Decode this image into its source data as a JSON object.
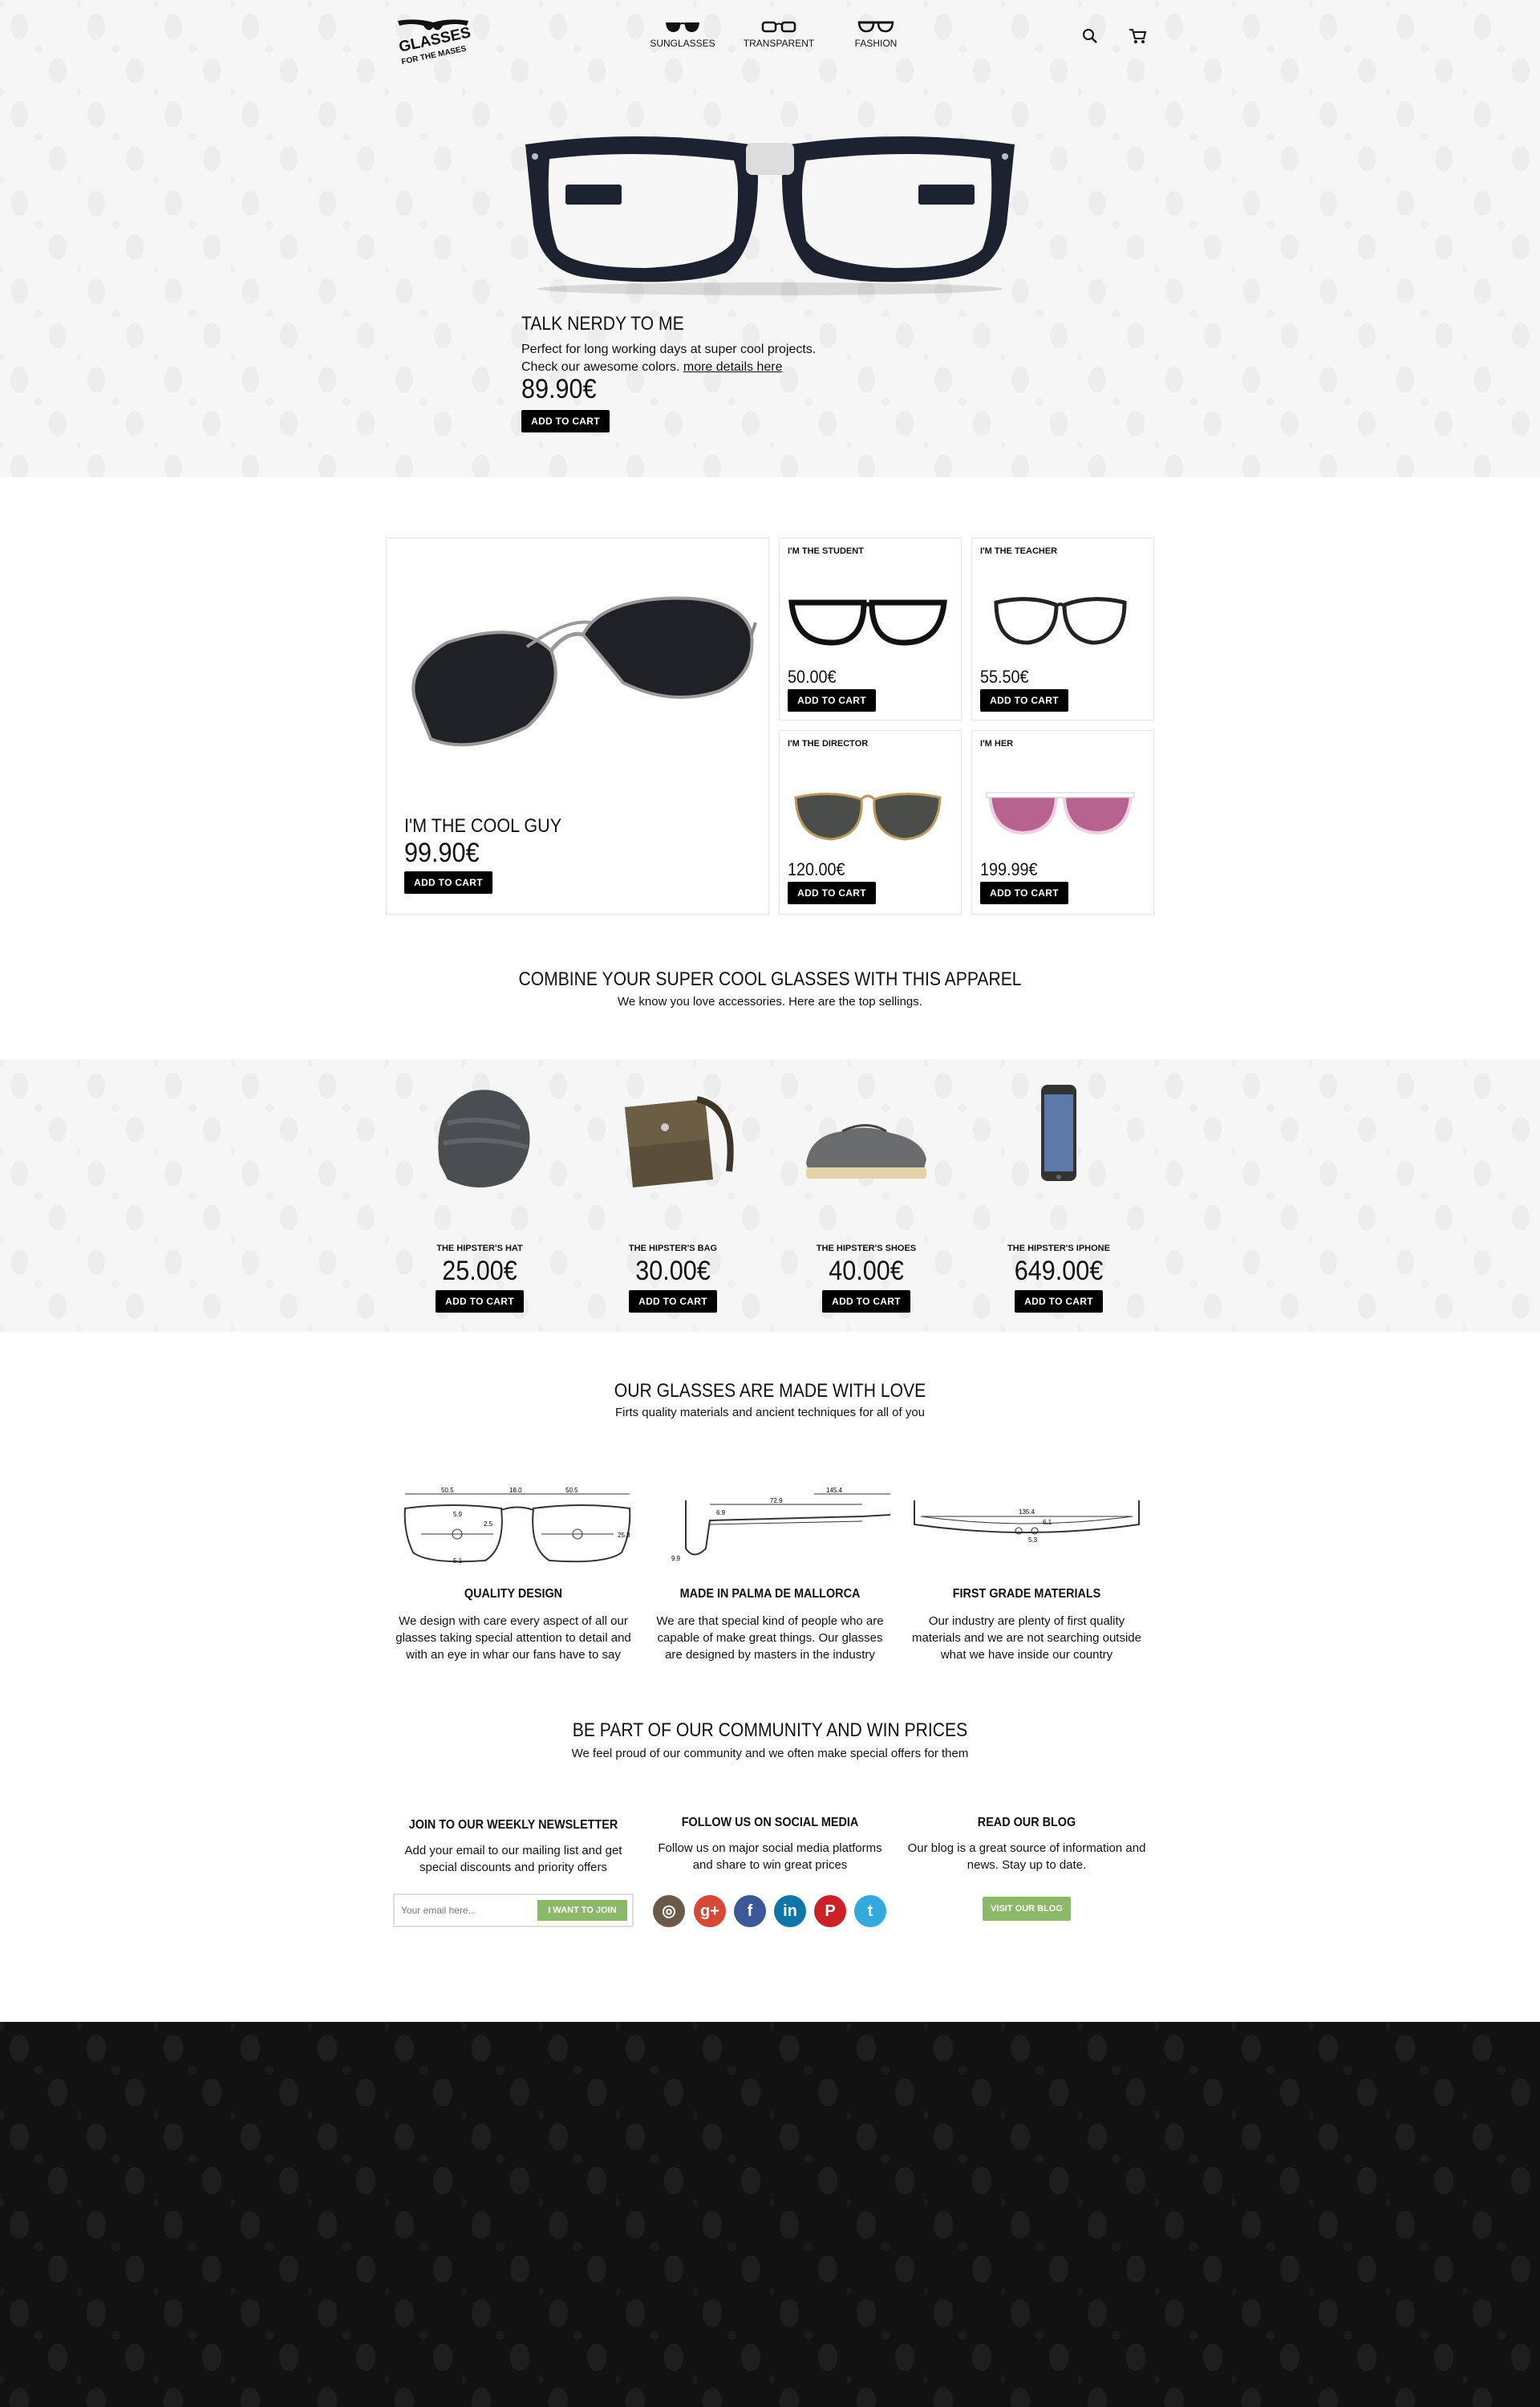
{
  "header": {
    "logo_text_1": "GLASSES",
    "logo_text_2": "FOR THE MASES",
    "nav": [
      {
        "label": "SUNGLASSES",
        "icon": "sunglasses-icon"
      },
      {
        "label": "TRANSPARENT",
        "icon": "transparent-glasses-icon"
      },
      {
        "label": "FASHION",
        "icon": "fashion-glasses-icon"
      }
    ],
    "search_icon": "search-icon",
    "cart_icon": "cart-icon"
  },
  "hero": {
    "title": "TALK NERDY TO ME",
    "desc_line1": "Perfect for long working days at super cool projects.",
    "desc_line2": "Check our awesome colors.",
    "details_link": "more details here",
    "price": "89.90€",
    "cta": "ADD TO CART"
  },
  "products": {
    "featured": {
      "title": "I'M THE COOL GUY",
      "price": "99.90€",
      "cta": "ADD TO CART"
    },
    "items": [
      {
        "title": "I'M THE STUDENT",
        "price": "50.00€",
        "cta": "ADD TO CART"
      },
      {
        "title": "I'M THE TEACHER",
        "price": "55.50€",
        "cta": "ADD TO CART"
      },
      {
        "title": "I'M THE DIRECTOR",
        "price": "120.00€",
        "cta": "ADD TO CART"
      },
      {
        "title": "I'M HER",
        "price": "199.99€",
        "cta": "ADD TO CART"
      }
    ]
  },
  "apparel": {
    "title": "COMBINE YOUR SUPER COOL GLASSES WITH THIS APPAREL",
    "subtitle": "We know you love accessories. Here are the top sellings.",
    "items": [
      {
        "name": "THE HIPSTER'S HAT",
        "price": "25.00€",
        "cta": "ADD TO CART"
      },
      {
        "name": "THE HIPSTER'S BAG",
        "price": "30.00€",
        "cta": "ADD TO CART"
      },
      {
        "name": "THE HIPSTER'S SHOES",
        "price": "40.00€",
        "cta": "ADD TO CART"
      },
      {
        "name": "THE HIPSTER'S IPHONE",
        "price": "649.00€",
        "cta": "ADD TO CART"
      }
    ]
  },
  "love": {
    "title": "OUR GLASSES ARE MADE WITH LOVE",
    "subtitle": "Firts quality materials and ancient techniques for all of you",
    "features": [
      {
        "title": "QUALITY DESIGN",
        "desc": "We design with care every aspect of all our glasses taking special attention to detail and with an eye in whar our fans have to say"
      },
      {
        "title": "MADE IN PALMA DE MALLORCA",
        "desc": "We are that special kind of people who are capable of make great things. Our glasses are designed by masters in the industry"
      },
      {
        "title": "FIRST GRADE MATERIALS",
        "desc": "Our industry are plenty of first quality materials and we are not searching outside what we have inside our country"
      }
    ],
    "dims_front": [
      "50.5",
      "18.0",
      "50.5",
      "5.9",
      "2.5",
      "25.8",
      "5.1"
    ],
    "dims_side": [
      "72.9",
      "145.4",
      "6.9",
      "9.9"
    ],
    "dims_top": [
      "135.4",
      "6.1",
      "5.3"
    ]
  },
  "community": {
    "title": "BE PART OF OUR COMMUNITY AND WIN PRICES",
    "subtitle": "We feel proud of our community and we often make special offers for them",
    "newsletter": {
      "title": "JOIN TO OUR WEEKLY NEWSLETTER",
      "desc": "Add your email to our mailing list and get special discounts and priority offers",
      "placeholder": "Your email here...",
      "cta": "I WANT TO JOIN"
    },
    "social": {
      "title": "FOLLOW US ON SOCIAL MEDIA",
      "desc": "Follow us on major social media platforms and share to win great prices",
      "icons": [
        {
          "name": "instagram-icon",
          "glyph": "◎",
          "color": "#6b5a4a"
        },
        {
          "name": "google-plus-icon",
          "glyph": "g+",
          "color": "#d64937"
        },
        {
          "name": "facebook-icon",
          "glyph": "f",
          "color": "#3b5998"
        },
        {
          "name": "linkedin-icon",
          "glyph": "in",
          "color": "#0e76a8"
        },
        {
          "name": "pinterest-icon",
          "glyph": "P",
          "color": "#cb2027"
        },
        {
          "name": "twitter-icon",
          "glyph": "t",
          "color": "#33aadd"
        }
      ]
    },
    "blog": {
      "title": "READ OUR BLOG",
      "desc": "Our blog is a great source of information and news. Stay up to date.",
      "cta": "VISIT OUR BLOG"
    }
  },
  "colors": {
    "accent_green": "#8cb86a",
    "black": "#000000",
    "footer": "#121212"
  }
}
